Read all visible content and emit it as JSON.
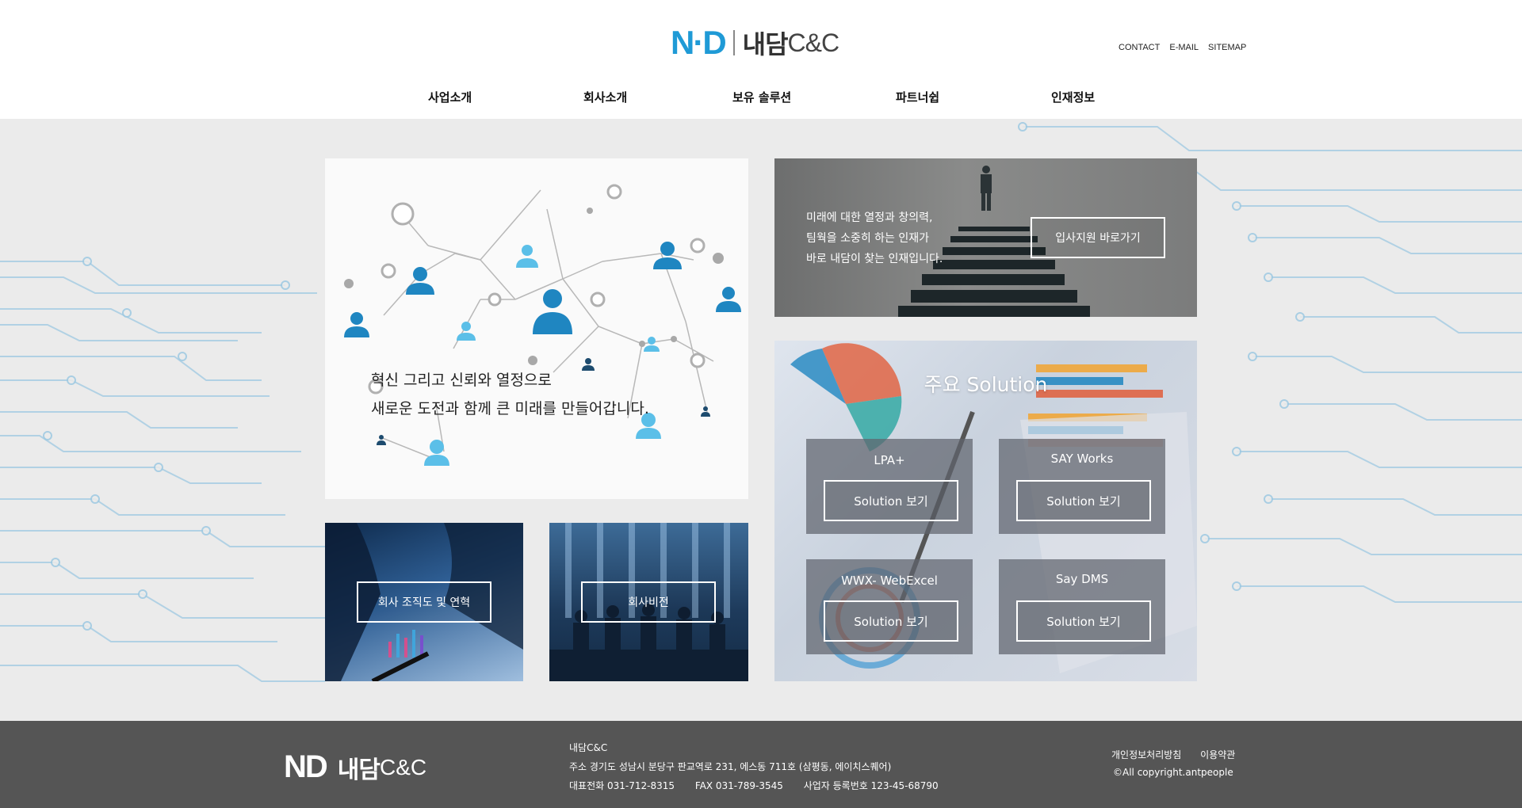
{
  "logo": {
    "nd": "N·D",
    "kr": "내담",
    "cc": "C&C"
  },
  "top_links": [
    "CONTACT",
    "E-MAIL",
    "SITEMAP"
  ],
  "gnb": [
    "사업소개",
    "회사소개",
    "보유 솔루션",
    "파트너쉽",
    "인재정보"
  ],
  "network_card": {
    "line1": "혁신 그리고 신뢰와 열정으로",
    "line2": "새로운 도전과 함께 큰 미래를 만들어갑니다."
  },
  "recruit_card": {
    "line1": "미래에 대한 열정과 창의력,",
    "line2": "팀웍을 소중히 하는 인재가",
    "line3": "바로 내담이 찾는 인재입니다.",
    "button": "입사지원 바로가기"
  },
  "solution_card": {
    "title": "주요 Solution",
    "items": [
      {
        "name": "LPA+",
        "button": "Solution 보기"
      },
      {
        "name": "SAY Works",
        "button": "Solution 보기"
      },
      {
        "name": "WWX- WebExcel",
        "button": "Solution 보기"
      },
      {
        "name": "Say DMS",
        "button": "Solution 보기"
      }
    ]
  },
  "org_card": {
    "button": "회사 조직도 및 연혁"
  },
  "vision_card": {
    "button": "회사비전"
  },
  "footer": {
    "logo": {
      "nd": "ND",
      "kr": "내담",
      "cc": "C&C"
    },
    "company": "내담C&C",
    "address": "주소 경기도 성남시 분당구 판교역로 231, 에스동 711호 (삼평동, 에이치스퀘어)",
    "tel": "대표전화 031-712-8315",
    "fax": "FAX 031-789-3545",
    "biz": "사업자 등록번호 123-45-68790",
    "links": [
      "개인정보처리방침",
      "이용약관"
    ],
    "copyright": "©All copyright.antpeople"
  },
  "colors": {
    "brand_blue": "#1f9ad6",
    "footer_bg": "#555555",
    "page_bg": "#ebebeb"
  }
}
